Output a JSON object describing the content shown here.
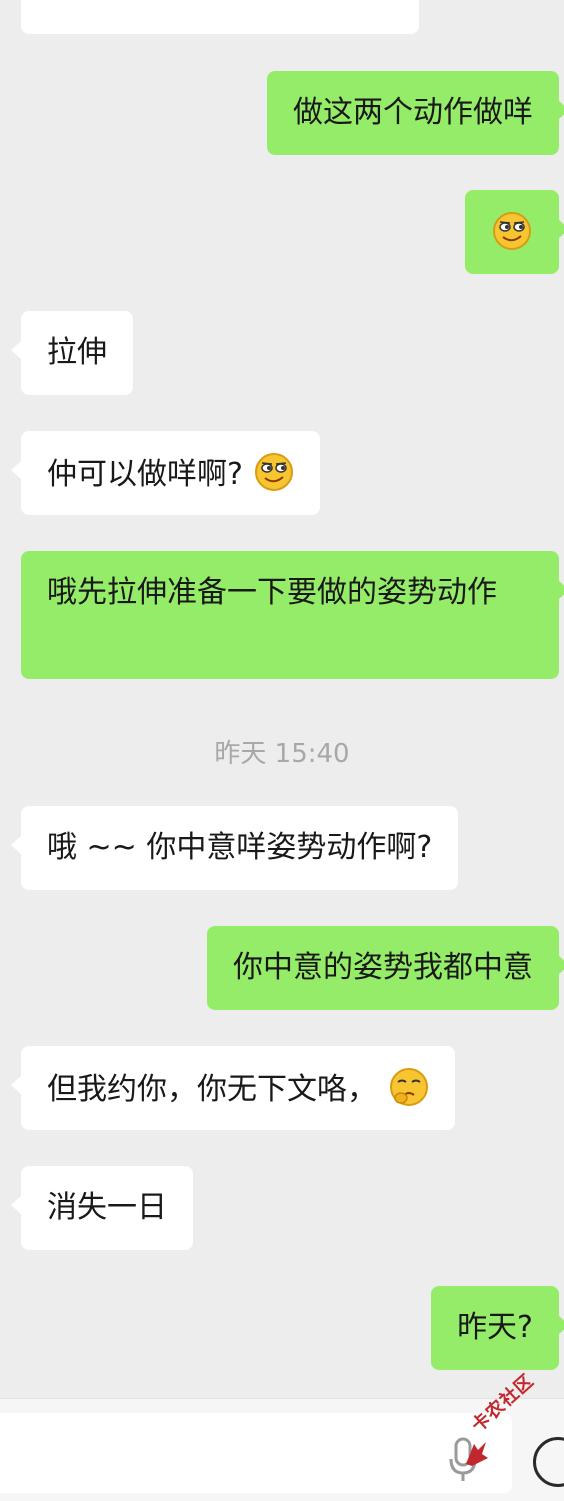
{
  "conversation": {
    "messages": [
      {
        "side": "right",
        "text": "做这两个动作做咩",
        "emoji": ""
      },
      {
        "side": "right",
        "text": "",
        "emoji": "smirk"
      },
      {
        "side": "left",
        "text": "拉伸",
        "emoji": ""
      },
      {
        "side": "left",
        "text": "仲可以做咩啊?",
        "emoji": "smirk"
      },
      {
        "side": "right",
        "text": "哦先拉伸准备一下要做的姿势动作",
        "emoji": ""
      },
      {
        "side": "left",
        "text": "哦 ~~ 你中意咩姿势动作啊?",
        "emoji": ""
      },
      {
        "side": "right",
        "text": "你中意的姿势我都中意",
        "emoji": ""
      },
      {
        "side": "left",
        "text": "但我约你，你无下文咯，",
        "emoji": "sad"
      },
      {
        "side": "left",
        "text": "消失一日",
        "emoji": ""
      },
      {
        "side": "right",
        "text": "昨天?",
        "emoji": ""
      }
    ],
    "timestamp": "昨天 15:40"
  },
  "watermark": {
    "text": "卡农社区"
  },
  "colors": {
    "background": "#ededed",
    "bubble_self": "#95ec69",
    "bubble_other": "#ffffff",
    "timestamp": "#a8a8a8"
  },
  "icons": {
    "input_voice": "microphone-icon",
    "input_emoji": "smiley-face-icon",
    "emoji_1": "smirk-emoji",
    "emoji_2": "sad-emoji"
  }
}
